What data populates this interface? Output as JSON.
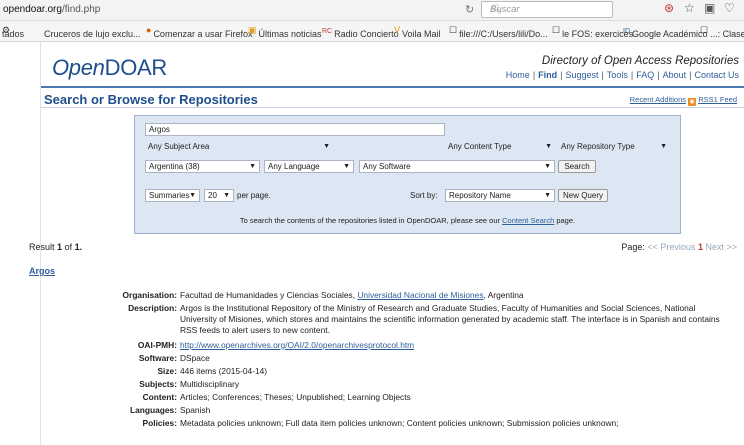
{
  "browser": {
    "url_domain": "opendoar.org",
    "url_path": "/find.php",
    "reload_icon": "reload-icon",
    "search_placeholder": "Buscar",
    "search_glyph": "🔍︎",
    "toolbar_icons": [
      "⊛",
      "☆",
      "▣",
      "♡"
    ]
  },
  "bookmarks": {
    "items": [
      {
        "icon": "⚙",
        "label": "tados"
      },
      {
        "icon": "",
        "label": "Cruceros de lujo exclu..."
      },
      {
        "icon": "●",
        "label": "Comenzar a usar Firefox"
      },
      {
        "icon": "▣",
        "label": "Últimas noticias"
      },
      {
        "icon": "RC",
        "label": "Radio Concierto"
      },
      {
        "icon": "V",
        "label": "Voila Mail"
      },
      {
        "icon": "☐",
        "label": "file:///C:/Users/lili/Do..."
      },
      {
        "icon": "☐",
        "label": "le FOS: exercices"
      },
      {
        "icon": "ID",
        "label": "Google Académico"
      },
      {
        "icon": "☐",
        "label": "...: Clases Virtuale"
      }
    ]
  },
  "header": {
    "logo_open": "Open",
    "logo_doar": "DOAR",
    "tagline": "Directory of Open Access Repositories",
    "nav": [
      "Home",
      "Find",
      "Suggest",
      "Tools",
      "FAQ",
      "About",
      "Contact Us"
    ],
    "nav_active": "Find"
  },
  "main": {
    "heading": "Search or Browse for Repositories",
    "recent_additions": "Recent Additions",
    "rss_icon": "rss",
    "rss_feed": "RSS1 Feed"
  },
  "search": {
    "query": "Argos",
    "subject": "Any Subject Area",
    "content_type": "Any Content Type",
    "repository_type": "Any Repository Type",
    "country": "Argentina (38)",
    "language": "Any Language",
    "software": "Any Software",
    "search_button": "Search",
    "display": "Summaries",
    "per_page_value": "20",
    "per_page_label": "per page.",
    "sort_label": "Sort by:",
    "sort_value": "Repository Name",
    "new_query_button": "New Query",
    "hint_prefix": "To search the contents of the repositories listed in OpenDOAR, please see our",
    "hint_link": "Content Search",
    "hint_suffix": "page.",
    "arrow": "▼"
  },
  "results": {
    "result_prefix": "Result",
    "result_from": "1",
    "result_of": "of",
    "result_total": "1.",
    "page_label": "Page:",
    "prev": "<< Previous",
    "current_page": "1",
    "next": "Next >>",
    "repository_name": "Argos"
  },
  "record": {
    "organisation_label": "Organisation:",
    "organisation_prefix": "Facultad de Humanidades y Ciencias Sociales,",
    "organisation_link": "Universidad Nacional de Misiones",
    "organisation_suffix": ", Argentina",
    "description_label": "Description:",
    "description": "Argos is the Institutional Repository of the Ministry of Research and Graduate Studies, Faculty of Humanities and Social Sciences, National University of Misiones, which stores and maintains the scientific information generated by academic staff. The interface is in Spanish and contains RSS feeds to alert users to new content.",
    "oai_label": "OAI-PMH:",
    "oai": "http://www.openarchives.org/OAI/2.0/openarchivesprotocol.htm",
    "software_label": "Software:",
    "software": "DSpace",
    "size_label": "Size:",
    "size": "446 items (2015-04-14)",
    "subjects_label": "Subjects:",
    "subjects": "Multidisciplinary",
    "content_label": "Content:",
    "content": "Articles; Conferences; Theses; Unpublished; Learning Objects",
    "languages_label": "Languages:",
    "languages": "Spanish",
    "policies_label": "Policies:",
    "policies": "Metadata policies unknown; Full data item policies unknown; Content policies unknown; Submission policies unknown;"
  }
}
